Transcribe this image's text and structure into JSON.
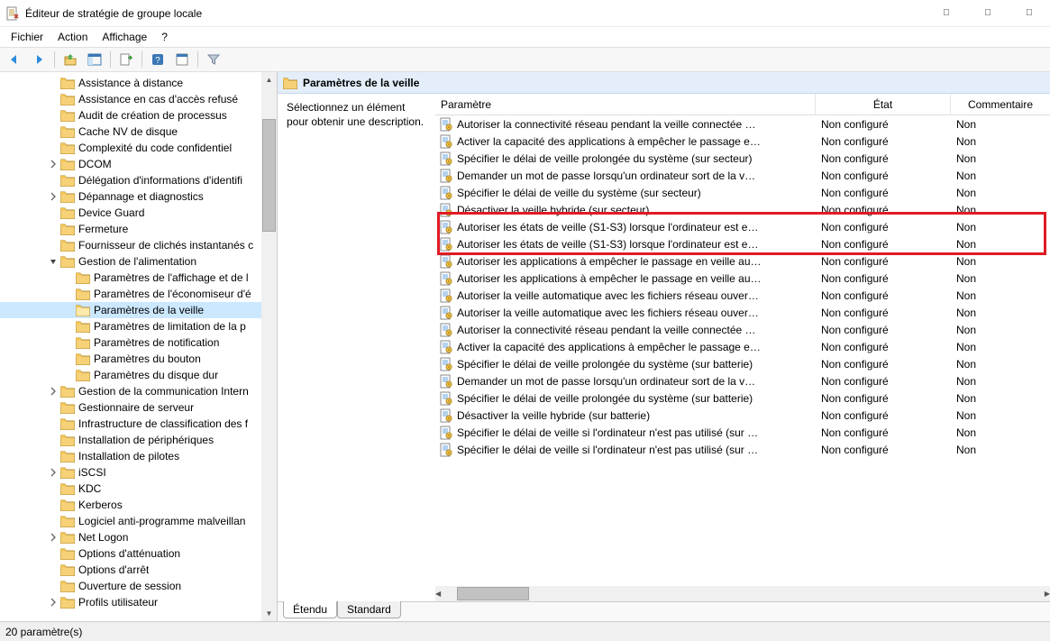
{
  "window": {
    "title": "Éditeur de stratégie de groupe locale"
  },
  "menu": [
    "Fichier",
    "Action",
    "Affichage",
    "?"
  ],
  "sidebar": {
    "selected_index": 14,
    "items": [
      {
        "indent": 3,
        "expander": "none",
        "label": "Assistance à distance"
      },
      {
        "indent": 3,
        "expander": "none",
        "label": "Assistance en cas d'accès refusé"
      },
      {
        "indent": 3,
        "expander": "none",
        "label": "Audit de création de processus"
      },
      {
        "indent": 3,
        "expander": "none",
        "label": "Cache NV de disque"
      },
      {
        "indent": 3,
        "expander": "none",
        "label": "Complexité du code confidentiel"
      },
      {
        "indent": 3,
        "expander": "closed",
        "label": "DCOM"
      },
      {
        "indent": 3,
        "expander": "none",
        "label": "Délégation d'informations d'identifi"
      },
      {
        "indent": 3,
        "expander": "closed",
        "label": "Dépannage et diagnostics"
      },
      {
        "indent": 3,
        "expander": "none",
        "label": "Device Guard"
      },
      {
        "indent": 3,
        "expander": "none",
        "label": "Fermeture"
      },
      {
        "indent": 3,
        "expander": "none",
        "label": "Fournisseur de clichés instantanés c"
      },
      {
        "indent": 3,
        "expander": "open",
        "label": "Gestion de l'alimentation"
      },
      {
        "indent": 4,
        "expander": "none",
        "label": "Paramètres de l'affichage et de l"
      },
      {
        "indent": 4,
        "expander": "none",
        "label": "Paramètres de l'économiseur d'é"
      },
      {
        "indent": 4,
        "expander": "none",
        "label": "Paramètres de la veille"
      },
      {
        "indent": 4,
        "expander": "none",
        "label": "Paramètres de limitation de la p"
      },
      {
        "indent": 4,
        "expander": "none",
        "label": "Paramètres de notification"
      },
      {
        "indent": 4,
        "expander": "none",
        "label": "Paramètres du bouton"
      },
      {
        "indent": 4,
        "expander": "none",
        "label": "Paramètres du disque dur"
      },
      {
        "indent": 3,
        "expander": "closed",
        "label": "Gestion de la communication Intern"
      },
      {
        "indent": 3,
        "expander": "none",
        "label": "Gestionnaire de serveur"
      },
      {
        "indent": 3,
        "expander": "none",
        "label": "Infrastructure de classification des f"
      },
      {
        "indent": 3,
        "expander": "none",
        "label": "Installation de périphériques"
      },
      {
        "indent": 3,
        "expander": "none",
        "label": "Installation de pilotes"
      },
      {
        "indent": 3,
        "expander": "closed",
        "label": "iSCSI"
      },
      {
        "indent": 3,
        "expander": "none",
        "label": "KDC"
      },
      {
        "indent": 3,
        "expander": "none",
        "label": "Kerberos"
      },
      {
        "indent": 3,
        "expander": "none",
        "label": "Logiciel anti-programme malveillan"
      },
      {
        "indent": 3,
        "expander": "closed",
        "label": "Net Logon"
      },
      {
        "indent": 3,
        "expander": "none",
        "label": "Options d'atténuation"
      },
      {
        "indent": 3,
        "expander": "none",
        "label": "Options d'arrêt"
      },
      {
        "indent": 3,
        "expander": "none",
        "label": "Ouverture de session"
      },
      {
        "indent": 3,
        "expander": "closed",
        "label": "Profils utilisateur"
      }
    ]
  },
  "content": {
    "title": "Paramètres de la veille",
    "desc_prompt": "Sélectionnez un élément pour obtenir une description.",
    "columns": {
      "param": "Paramètre",
      "state": "État",
      "comment": "Commentaire"
    },
    "rows": [
      {
        "param": "Autoriser la connectivité réseau pendant la veille connectée …",
        "state": "Non configuré",
        "comment": "Non"
      },
      {
        "param": "Activer la capacité des applications à empêcher le passage e…",
        "state": "Non configuré",
        "comment": "Non"
      },
      {
        "param": "Spécifier le délai de veille prolongée du système (sur secteur)",
        "state": "Non configuré",
        "comment": "Non"
      },
      {
        "param": "Demander un mot de passe lorsqu'un ordinateur sort de la v…",
        "state": "Non configuré",
        "comment": "Non"
      },
      {
        "param": "Spécifier le délai de veille du système (sur secteur)",
        "state": "Non configuré",
        "comment": "Non"
      },
      {
        "param": "Désactiver la veille hybride (sur secteur)",
        "state": "Non configuré",
        "comment": "Non"
      },
      {
        "param": "Autoriser les états de veille (S1-S3) lorsque l'ordinateur est e…",
        "state": "Non configuré",
        "comment": "Non",
        "hi": true
      },
      {
        "param": "Autoriser les états de veille (S1-S3) lorsque l'ordinateur est e…",
        "state": "Non configuré",
        "comment": "Non",
        "hi": true
      },
      {
        "param": "Autoriser les applications à empêcher le passage en veille au…",
        "state": "Non configuré",
        "comment": "Non"
      },
      {
        "param": "Autoriser les applications à empêcher le passage en veille au…",
        "state": "Non configuré",
        "comment": "Non"
      },
      {
        "param": "Autoriser la veille automatique avec les fichiers réseau ouver…",
        "state": "Non configuré",
        "comment": "Non"
      },
      {
        "param": "Autoriser la veille automatique avec les fichiers réseau ouver…",
        "state": "Non configuré",
        "comment": "Non"
      },
      {
        "param": "Autoriser la connectivité réseau pendant la veille connectée …",
        "state": "Non configuré",
        "comment": "Non"
      },
      {
        "param": "Activer la capacité des applications à empêcher le passage e…",
        "state": "Non configuré",
        "comment": "Non"
      },
      {
        "param": "Spécifier le délai de veille prolongée du système (sur batterie)",
        "state": "Non configuré",
        "comment": "Non"
      },
      {
        "param": "Demander un mot de passe lorsqu'un ordinateur sort de la v…",
        "state": "Non configuré",
        "comment": "Non"
      },
      {
        "param": "Spécifier le délai de veille prolongée du système (sur batterie)",
        "state": "Non configuré",
        "comment": "Non"
      },
      {
        "param": "Désactiver la veille hybride (sur batterie)",
        "state": "Non configuré",
        "comment": "Non"
      },
      {
        "param": "Spécifier le délai de veille si l'ordinateur n'est pas utilisé (sur …",
        "state": "Non configuré",
        "comment": "Non"
      },
      {
        "param": "Spécifier le délai de veille si l'ordinateur n'est pas utilisé (sur …",
        "state": "Non configuré",
        "comment": "Non"
      }
    ]
  },
  "tabs": {
    "extended": "Étendu",
    "standard": "Standard"
  },
  "status": "20 paramètre(s)"
}
